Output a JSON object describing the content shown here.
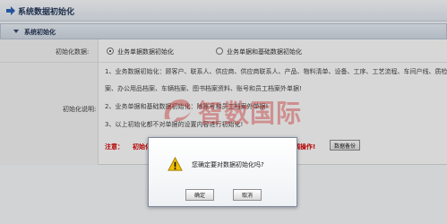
{
  "header": {
    "title": "系统数据初始化",
    "title_icon": "blue-arrow-icon"
  },
  "section": {
    "title": "系统初始化"
  },
  "form": {
    "init_data_label": "初始化数据:",
    "options": [
      {
        "label": "业务单据数据初始化",
        "selected": true
      },
      {
        "label": "业务单据和基础数据初始化",
        "selected": false
      }
    ],
    "init_desc_label": "初始化说明:",
    "desc_lines": [
      "1、业务数据初始化：顾客户、联系人、供应商、供应商联系人、产品、物料清单、设备、工序、工艺流程、车间户线、质检方",
      "案、办公用品档案、车辆档案、图书档案资料、账号和员工档案外单据!",
      "2、业务单据和基础数据初始化：除账号和员工档案外单据!",
      "3、以上初始化都不对单据的设置内容进行初始化!"
    ],
    "note_prefix": "注意：",
    "note_fragment_1": "初始化后",
    "note_fragment_2": "调操作!",
    "backup_button": "数据备份"
  },
  "watermark": {
    "text": "智数国际",
    "color": "#c21b1b"
  },
  "dialog": {
    "message": "您确定要对数据初始化吗?",
    "ok_label": "确定",
    "cancel_label": "取消",
    "icon": "warning-icon"
  },
  "colors": {
    "header_text": "#25385a",
    "note_red": "#d40000",
    "warning_yellow": "#f3c000"
  }
}
